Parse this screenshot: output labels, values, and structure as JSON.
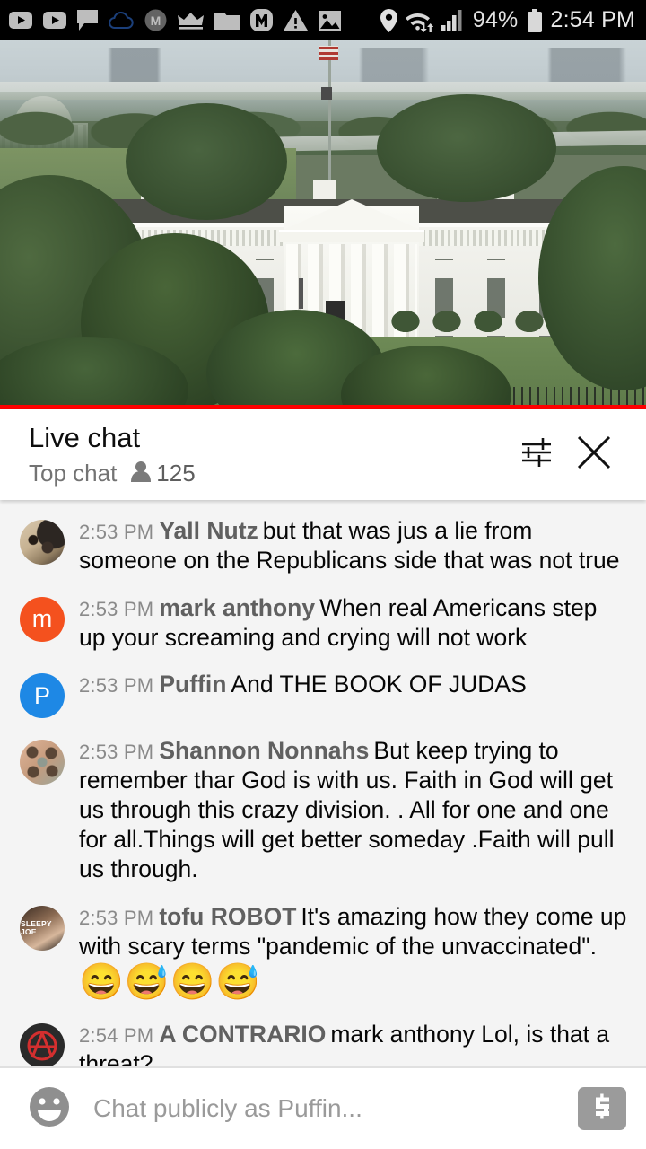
{
  "statusbar": {
    "icons_left": [
      "youtube-icon",
      "youtube-icon",
      "chat-bubble-icon",
      "cloud-outline-icon",
      "m-circle-icon",
      "crown-icon",
      "folder-icon",
      "m-badge-icon",
      "warning-triangle-icon",
      "image-icon"
    ],
    "location_icon": "location-pin-icon",
    "wifi_icon": "wifi-transfer-icon",
    "signal_icon": "cellular-signal-icon",
    "battery_percent": "94%",
    "battery_icon": "battery-icon",
    "time": "2:54 PM"
  },
  "video": {
    "name": "white-house-live-stream",
    "progress_color": "#ff0000",
    "progress_percent": 100
  },
  "chat_header": {
    "title": "Live chat",
    "subtitle": "Top chat",
    "viewer_count": "125",
    "viewer_icon": "person-icon",
    "settings_icon": "sliders-icon",
    "close_icon": "close-icon"
  },
  "messages": [
    {
      "time": "2:53 PM",
      "author": "Yall Nutz",
      "text": "but that was jus a lie from someone on the Republicans side that was not true",
      "avatar_type": "dog",
      "avatar_letter": ""
    },
    {
      "time": "2:53 PM",
      "author": "mark anthony",
      "text": "When real Americans step up your screaming and crying will not work",
      "avatar_type": "letter",
      "avatar_letter": "m",
      "avatar_color": "#F4511E"
    },
    {
      "time": "2:53 PM",
      "author": "Puffin",
      "text": "And THE BOOK OF JUDAS",
      "avatar_type": "letter",
      "avatar_letter": "P",
      "avatar_color": "#1E88E5"
    },
    {
      "time": "2:53 PM",
      "author": "Shannon Nonnahs",
      "text": "But keep trying to remember thar God is with us. Faith in God will get us through this crazy division. . All for one and one for all.Things will get better someday .Faith will pull us through.",
      "avatar_type": "leopard",
      "avatar_letter": ""
    },
    {
      "time": "2:53 PM",
      "author": "tofu ROBOT",
      "text": "It's amazing how they come up with scary terms \"pandemic of the unvaccinated\".",
      "emoji": "😄😅😄😅",
      "avatar_type": "sleepy-joe",
      "avatar_letter": "",
      "avatar_tag": "SLEEPY JOE"
    },
    {
      "time": "2:54 PM",
      "author": "A CONTRARIO",
      "text": "mark anthony Lol, is that a threat?",
      "avatar_type": "anarchy",
      "avatar_letter": ""
    }
  ],
  "input_bar": {
    "emoji_icon": "emoji-smiley-icon",
    "placeholder": "Chat publicly as Puffin...",
    "value": "",
    "money_icon": "super-chat-dollar-icon"
  }
}
